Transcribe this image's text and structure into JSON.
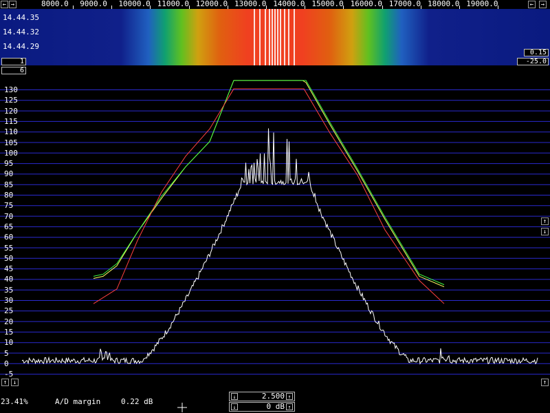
{
  "freq_axis": {
    "labels": [
      "8000.0",
      "9000.0",
      "10000.0",
      "11000.0",
      "12000.0",
      "13000.0",
      "14000.0",
      "15000.0",
      "16000.0",
      "17000.0",
      "18000.0",
      "19000.0"
    ]
  },
  "waterfall": {
    "times": [
      "14.44.35",
      "14.44.32",
      "14.44.29"
    ],
    "left_value": "1",
    "right_top_value": "0.15",
    "right_bottom_value": "-25.0"
  },
  "spectrum": {
    "top_left_value": "6",
    "y_ticks": [
      "130",
      "125",
      "120",
      "115",
      "110",
      "105",
      "100",
      "95",
      "90",
      "85",
      "80",
      "75",
      "70",
      "65",
      "60",
      "55",
      "50",
      "45",
      "40",
      "35",
      "30",
      "25",
      "20",
      "15",
      "10",
      "5",
      "0",
      "-5"
    ],
    "colors": {
      "grid": "#2a2ad0",
      "white": "#ffffff",
      "green": "#40ff40",
      "yellow": "#ffff60",
      "red": "#ff4040"
    }
  },
  "status": {
    "percent": "23.41%",
    "ad_margin_label": "A/D margin",
    "ad_margin_value": "0.22 dB"
  },
  "controls": {
    "gain_value": "2.500",
    "offset_value": "0 dB"
  },
  "icons": {
    "left_arrow": "←",
    "right_arrow": "→",
    "up_arrow": "↑",
    "down_arrow": "↓"
  }
}
